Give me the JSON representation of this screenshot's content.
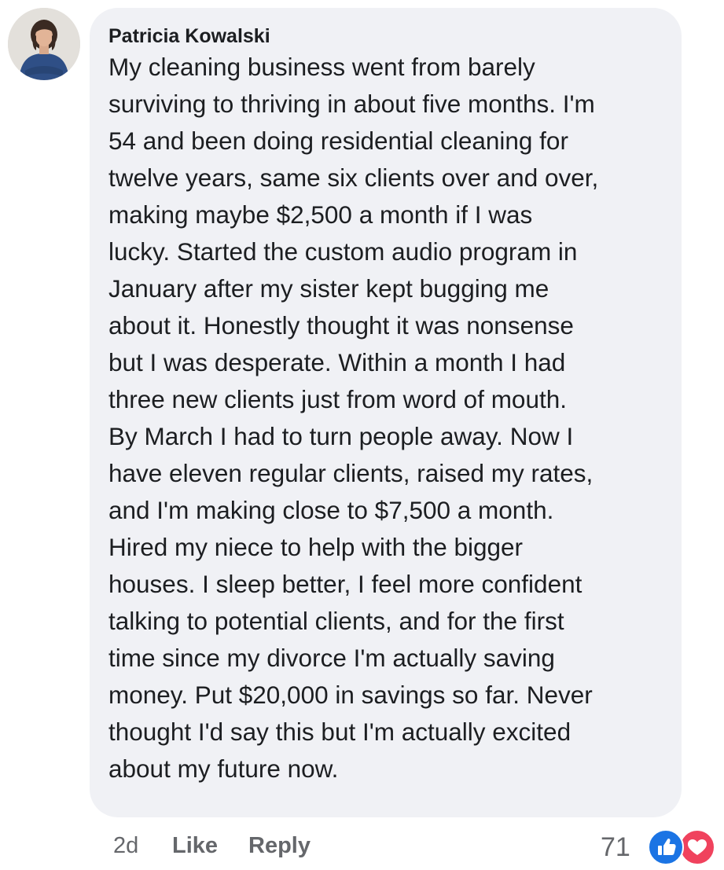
{
  "comment": {
    "author": "Patricia Kowalski",
    "lines": [
      "My cleaning business went from barely",
      "surviving to thriving in about five months. I'm",
      "54 and been doing residential cleaning for",
      "twelve years, same six clients over and over,",
      "making maybe $2,500 a month if I was",
      "lucky. Started the custom audio program in",
      "January after my sister kept bugging me",
      "about it. Honestly thought it was nonsense",
      "but I was desperate. Within a month I had",
      "three new clients just from word of mouth.",
      "By March I had to turn people away. Now I",
      "have eleven regular clients, raised my rates,",
      "and I'm making close to $7,500 a month.",
      "Hired my niece to help with the bigger",
      "houses. I sleep better, I feel more confident",
      "talking to potential clients, and for the first",
      "time since my divorce I'm actually saving",
      "money. Put $20,000 in savings so far. Never",
      "thought I'd say this but I'm actually excited",
      "about my future now."
    ]
  },
  "footer": {
    "time": "2d",
    "like_label": "Like",
    "reply_label": "Reply",
    "reaction_count": "71",
    "reactions": [
      "like-icon",
      "love-icon"
    ]
  },
  "colors": {
    "bubble": "#f0f1f5",
    "text": "#1c1e21",
    "meta": "#65676b",
    "like_blue": "#1b74e4",
    "love_red": "#f0425d"
  }
}
